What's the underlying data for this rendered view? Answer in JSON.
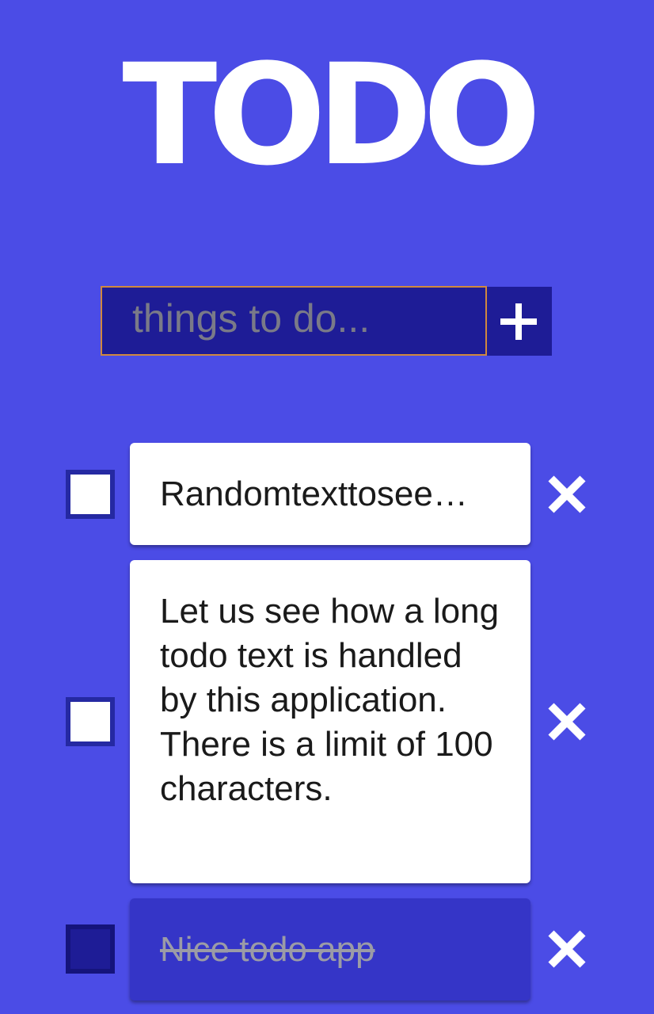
{
  "header": {
    "title": "TODO"
  },
  "new_todo": {
    "placeholder": "things to do...",
    "value": ""
  },
  "todos": [
    {
      "text": "Randomtexttosee…",
      "completed": false
    },
    {
      "text": "Let us see how a long todo text is handled by this application. There is a limit of 100 characters.",
      "completed": false
    },
    {
      "text": "Nice todo app",
      "completed": true
    }
  ],
  "icons": {
    "add": "plus-icon",
    "delete": "close-icon",
    "checkbox": "checkbox-icon"
  },
  "colors": {
    "background": "#4b4ce6",
    "input_background": "#1e1c96",
    "input_border": "#d0883e",
    "checkbox_border": "#2529a2",
    "completed_card": "#3535c7"
  }
}
